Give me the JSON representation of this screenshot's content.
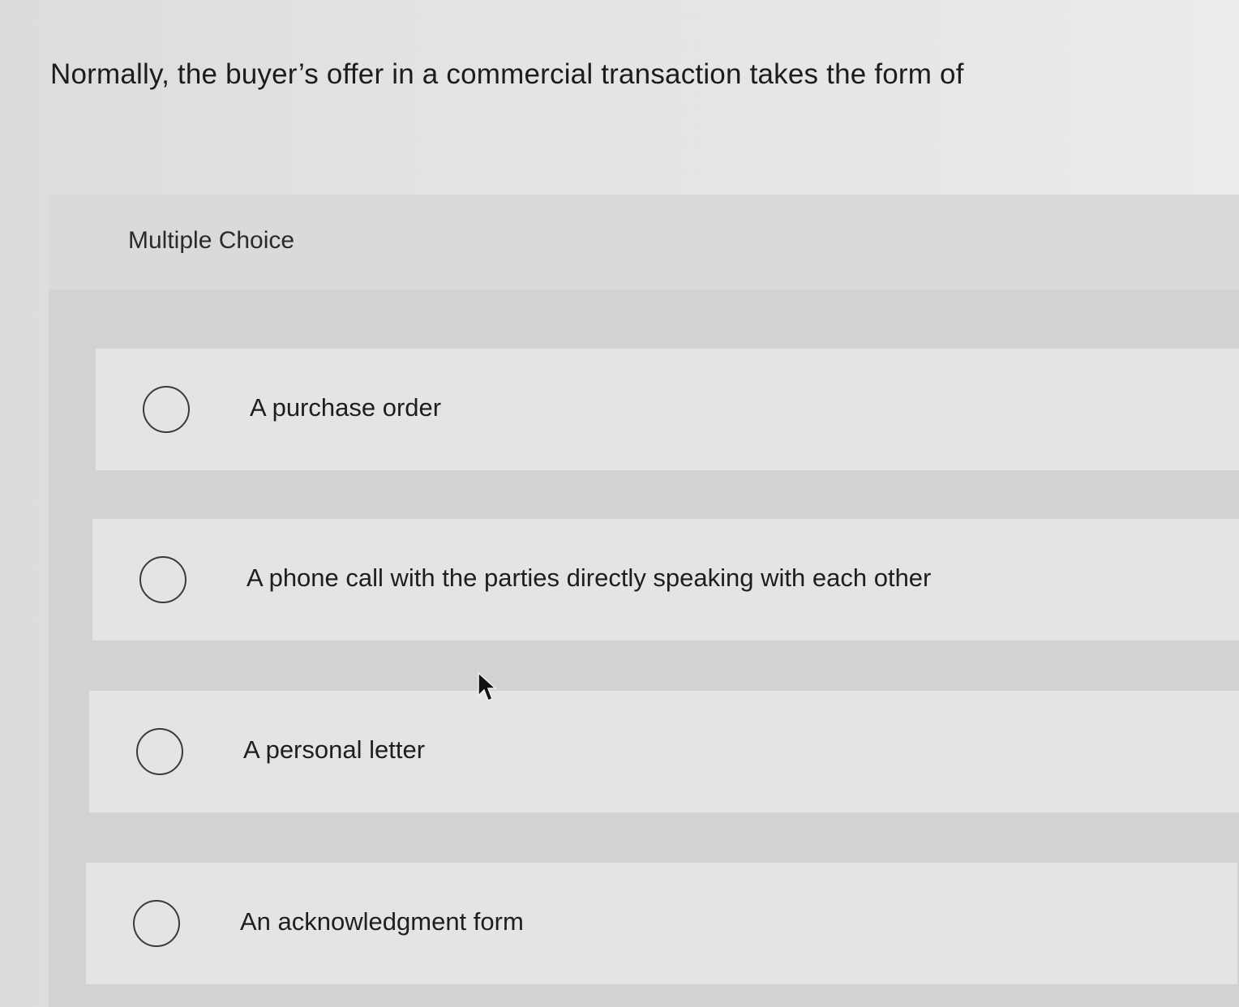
{
  "question": {
    "text": "Normally, the buyer’s offer in a commercial transaction takes the form of"
  },
  "panel": {
    "title": "Multiple Choice"
  },
  "options": [
    {
      "label": "A purchase order"
    },
    {
      "label": "A phone call with the parties directly speaking with each other"
    },
    {
      "label": "A personal letter"
    },
    {
      "label": "An acknowledgment form"
    }
  ]
}
